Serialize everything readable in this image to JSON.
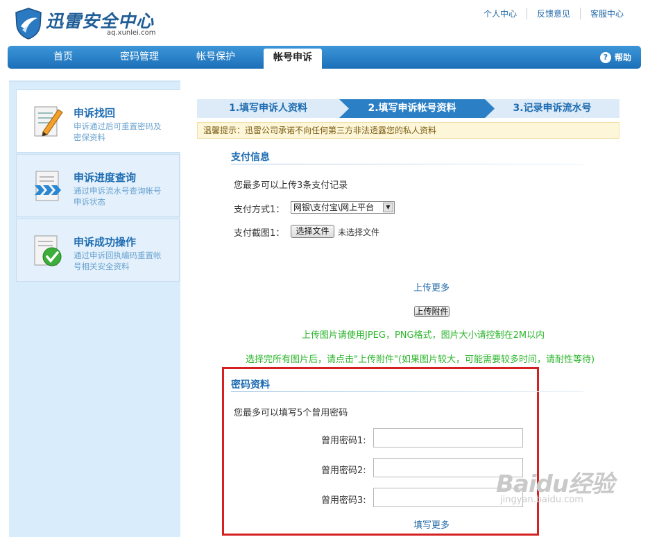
{
  "header": {
    "logo_title": "迅雷安全中心",
    "logo_domain": "aq.xunlei.com",
    "links": [
      "个人中心",
      "反馈意见",
      "客服中心"
    ]
  },
  "nav": {
    "items": [
      "首页",
      "密码管理",
      "帐号保护",
      "帐号申诉"
    ],
    "active": "帐号申诉",
    "help": "帮助"
  },
  "sidebar": {
    "items": [
      {
        "title": "申诉找回",
        "desc": "申诉通过后可重置密码及密保资料",
        "icon": "pencil-doc-icon"
      },
      {
        "title": "申诉进度查询",
        "desc": "通过申诉流水号查询帐号申诉状态",
        "icon": "arrows-doc-icon"
      },
      {
        "title": "申诉成功操作",
        "desc": "通过申诉回执编码重置帐号相关安全资料",
        "icon": "check-doc-icon"
      }
    ]
  },
  "steps": [
    "1.填写申诉人资料",
    "2.填写申诉帐号资料",
    "3.记录申诉流水号"
  ],
  "tip": "温馨提示：迅雷公司承诺不向任何第三方非法透露您的私人资料",
  "payment": {
    "title": "支付信息",
    "intro": "您最多可以上传3条支付记录",
    "method_label": "支付方式1：",
    "method_value": "网银\\支付宝\\网上平台",
    "screenshot_label": "支付截图1：",
    "choose_file": "选择文件",
    "no_file": "未选择文件",
    "upload_more": "上传更多",
    "upload_attach": "上传附件",
    "hint1": "上传图片请使用JPEG，PNG格式，图片大小请控制在2M以内",
    "hint2": "选择完所有图片后，请点击\"上传附件\"(如果图片较大，可能需要较多时间，请耐性等待)"
  },
  "password": {
    "title": "密码资料",
    "intro": "您最多可以填写5个曾用密码",
    "labels": [
      "曾用密码1:",
      "曾用密码2:",
      "曾用密码3:"
    ],
    "fill_more": "填写更多"
  },
  "watermark": {
    "main": "Baidu经验",
    "sub": "jingyan.baidu.com"
  },
  "colors": {
    "brand": "#1f5d96",
    "nav": "#2a7cc6",
    "highlight": "#d42020",
    "hint": "#2bb52b"
  }
}
